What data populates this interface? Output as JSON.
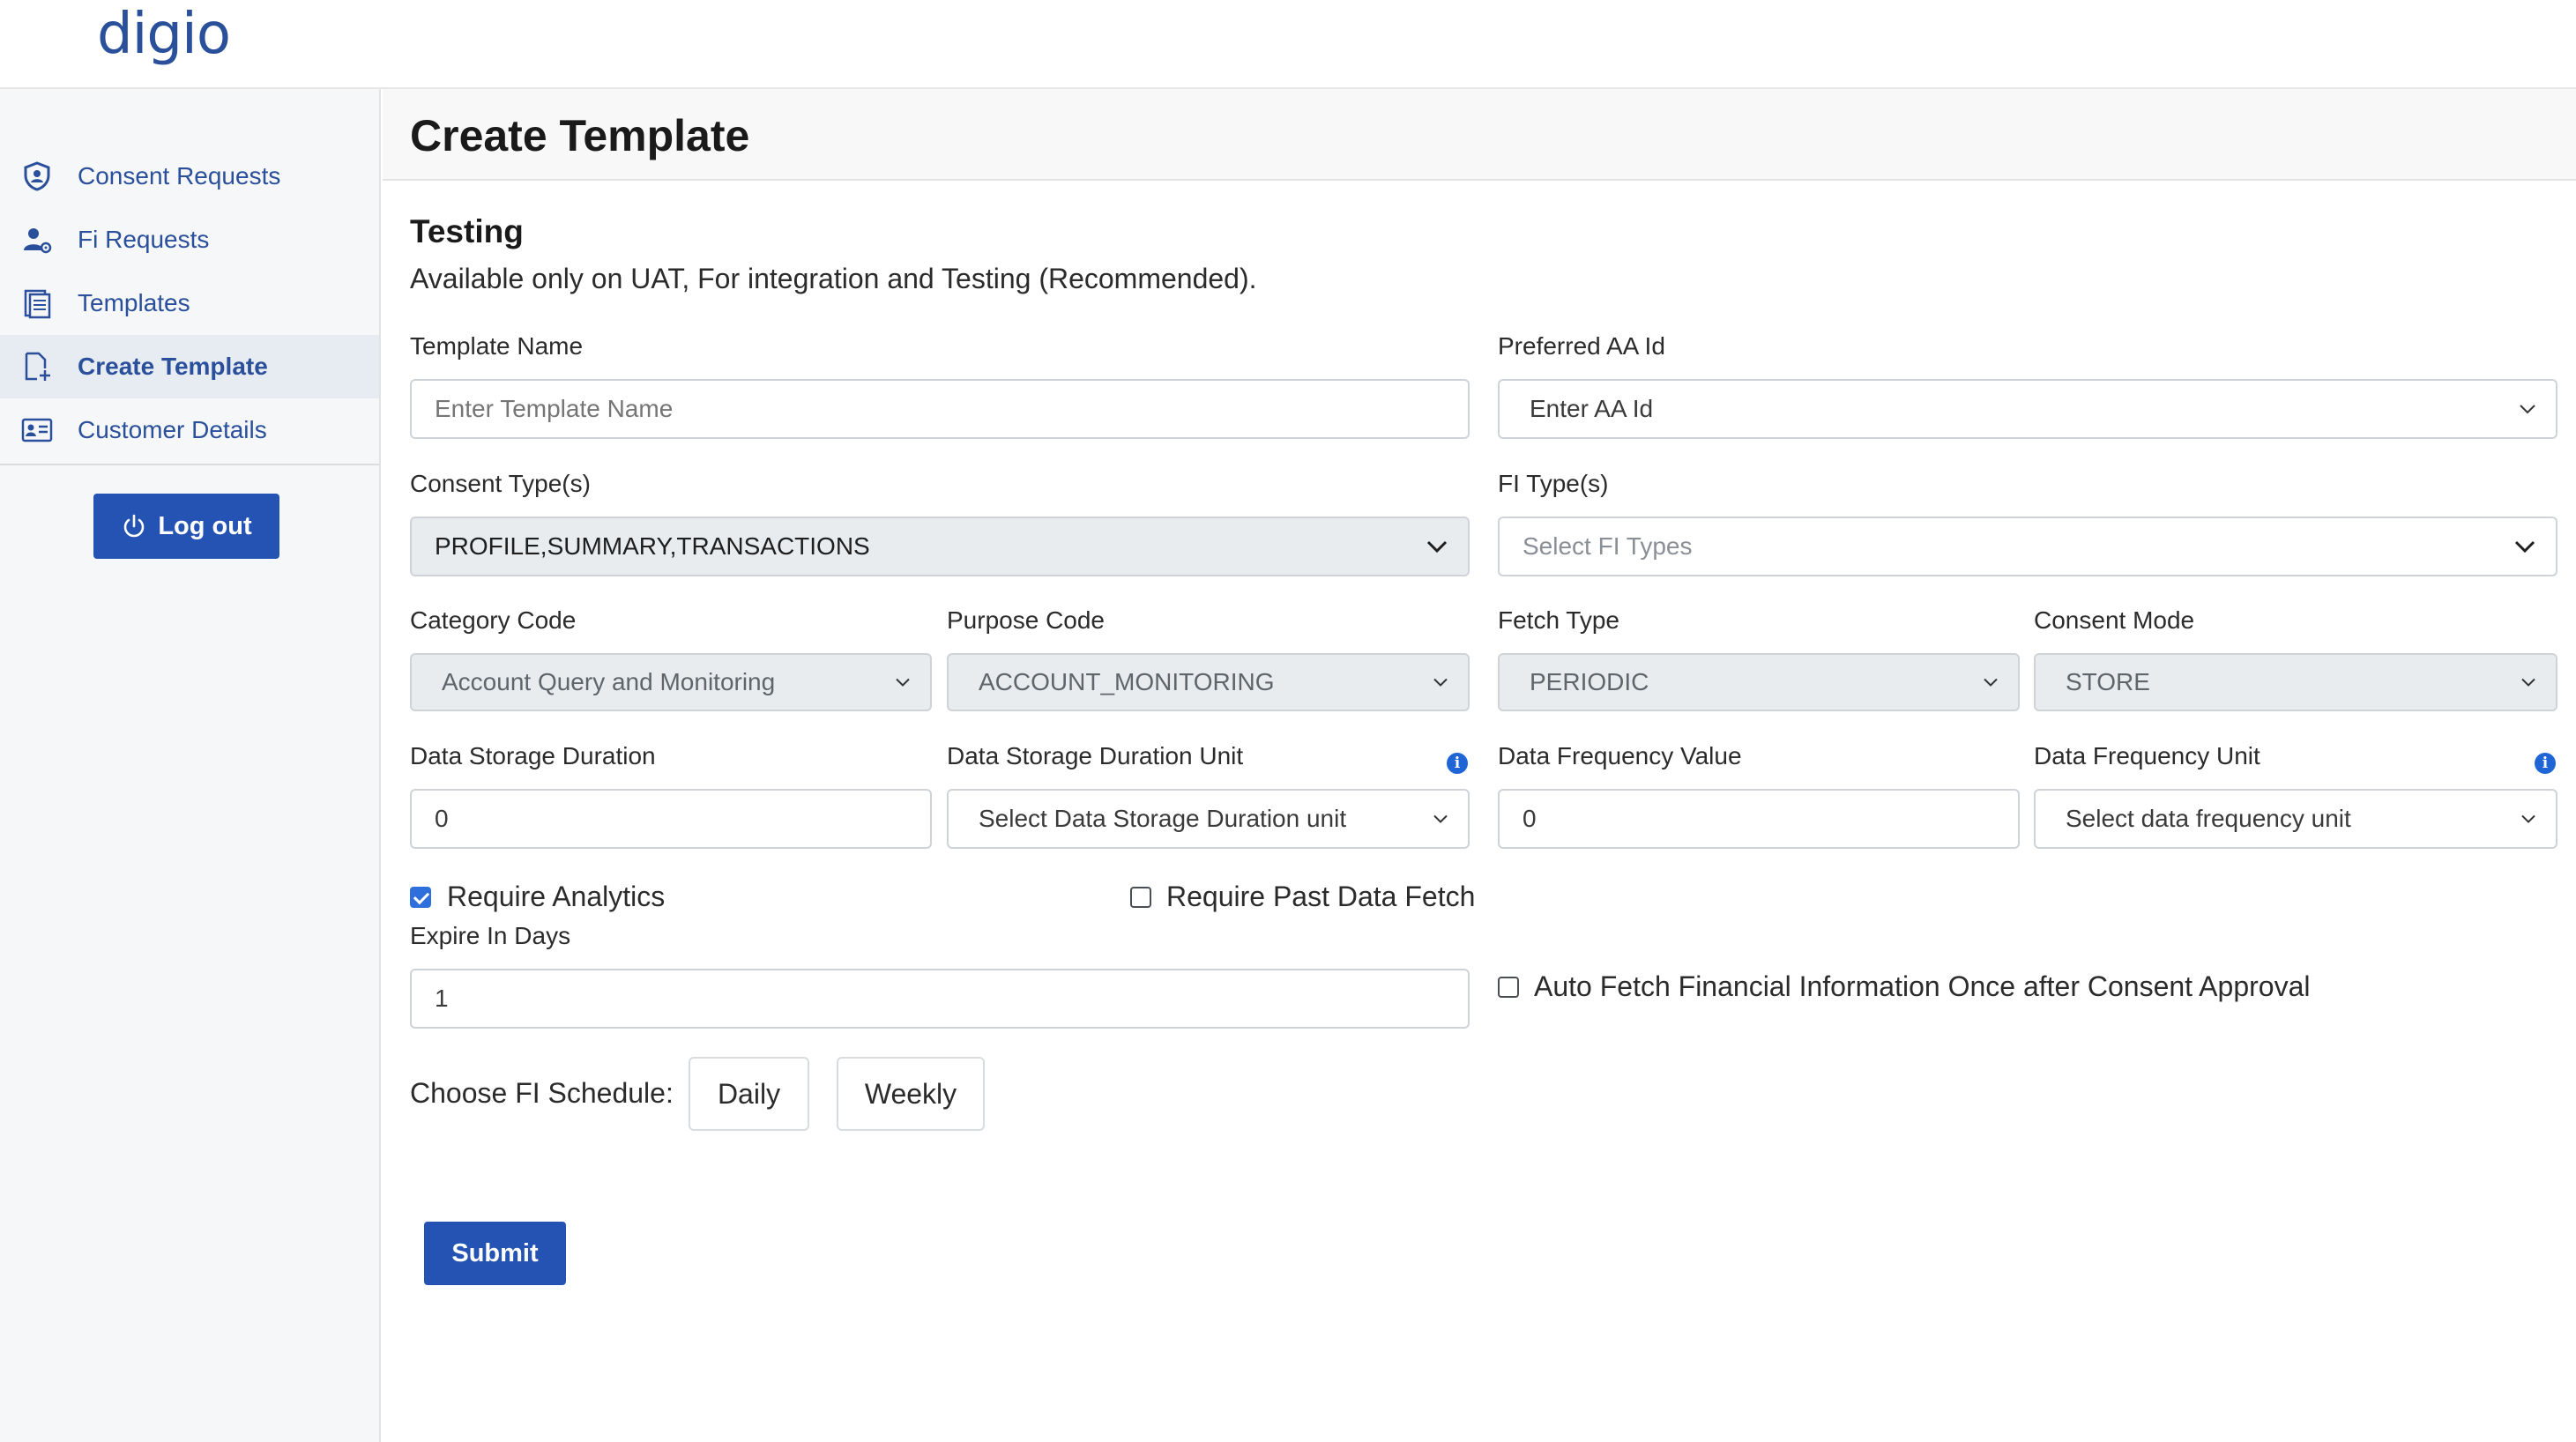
{
  "brand": {
    "logo_text": "digio",
    "accent": "#2453b3",
    "link_color": "#2a4f9b"
  },
  "sidebar": {
    "items": [
      {
        "label": "Consent Requests",
        "icon": "shield-user-icon",
        "active": false
      },
      {
        "label": "Fi Requests",
        "icon": "user-gear-icon",
        "active": false
      },
      {
        "label": "Templates",
        "icon": "document-list-icon",
        "active": false
      },
      {
        "label": "Create Template",
        "icon": "document-add-icon",
        "active": true
      },
      {
        "label": "Customer Details",
        "icon": "id-card-icon",
        "active": false
      }
    ],
    "logout_label": "Log out"
  },
  "page": {
    "title": "Create Template"
  },
  "section": {
    "title": "Testing",
    "description": "Available only on UAT, For integration and Testing (Recommended)."
  },
  "form": {
    "template_name": {
      "label": "Template Name",
      "placeholder": "Enter Template Name",
      "value": ""
    },
    "preferred_aa": {
      "label": "Preferred AA Id",
      "value": "Enter AA Id"
    },
    "consent_types": {
      "label": "Consent Type(s)",
      "value": "PROFILE,SUMMARY,TRANSACTIONS"
    },
    "fi_types": {
      "label": "FI Type(s)",
      "placeholder": "Select FI Types"
    },
    "category_code": {
      "label": "Category Code",
      "value": "Account Query and Monitoring"
    },
    "purpose_code": {
      "label": "Purpose Code",
      "value": "ACCOUNT_MONITORING"
    },
    "fetch_type": {
      "label": "Fetch Type",
      "value": "PERIODIC"
    },
    "consent_mode": {
      "label": "Consent Mode",
      "value": "STORE"
    },
    "data_storage_duration": {
      "label": "Data Storage Duration",
      "value": "0"
    },
    "data_storage_duration_unit": {
      "label": "Data Storage Duration Unit",
      "placeholder": "Select Data Storage Duration unit"
    },
    "data_frequency_value": {
      "label": "Data Frequency Value",
      "value": "0"
    },
    "data_frequency_unit": {
      "label": "Data Frequency Unit",
      "placeholder": "Select data frequency unit"
    },
    "require_analytics": {
      "label": "Require Analytics",
      "checked": true
    },
    "require_past_data_fetch": {
      "label": "Require Past Data Fetch",
      "checked": false
    },
    "expire_in_days": {
      "label": "Expire In Days",
      "value": "1"
    },
    "auto_fetch": {
      "label": "Auto Fetch Financial Information Once after Consent Approval",
      "checked": false
    },
    "schedule": {
      "label": "Choose FI Schedule:",
      "options": [
        "Daily",
        "Weekly"
      ]
    },
    "submit_label": "Submit"
  }
}
